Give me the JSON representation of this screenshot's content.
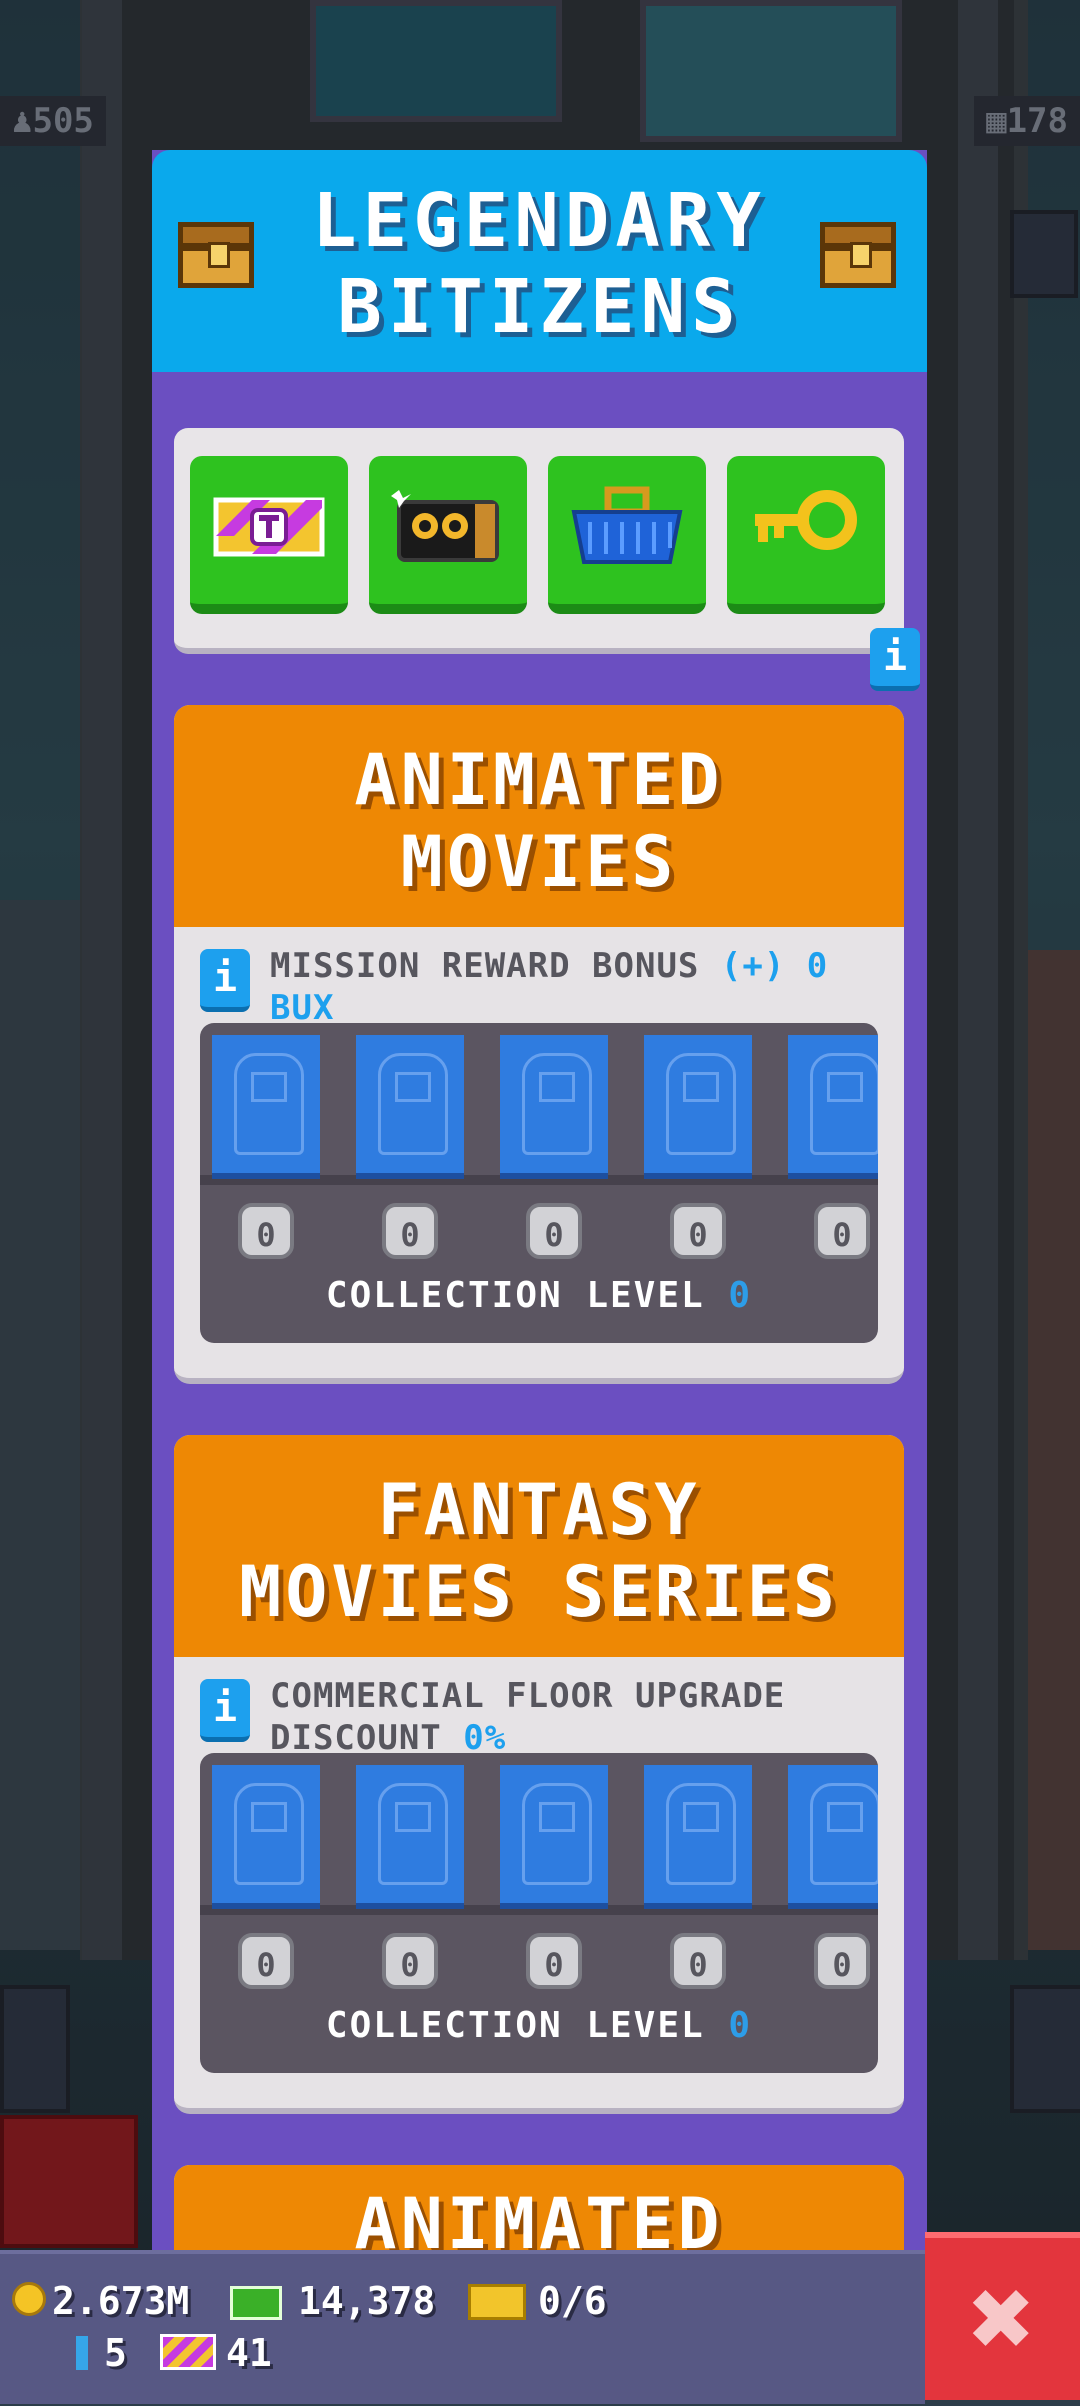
{
  "hud": {
    "population": "505",
    "floors": "178"
  },
  "header": {
    "title": "LEGENDARY\nBITIZENS"
  },
  "tools": [
    {
      "name": "tower-bux-ticket"
    },
    {
      "name": "vip-camera"
    },
    {
      "name": "shopping-basket"
    },
    {
      "name": "golden-key"
    }
  ],
  "info_label": "i",
  "collections": [
    {
      "title": "ANIMATED\nMOVIES",
      "bonus_label": "MISSION REWARD BONUS ",
      "bonus_value": "(+) 0 BUX",
      "counts": [
        "0",
        "0",
        "0",
        "0",
        "0"
      ],
      "level_label": "COLLECTION LEVEL ",
      "level_value": "0"
    },
    {
      "title": "FANTASY\nMOVIES  SERIES",
      "bonus_label": "COMMERCIAL FLOOR UPGRADE DISCOUNT ",
      "bonus_value": "0%",
      "counts": [
        "0",
        "0",
        "0",
        "0",
        "0"
      ],
      "level_label": "COLLECTION LEVEL ",
      "level_value": "0"
    },
    {
      "title": "ANIMATED"
    }
  ],
  "resources": {
    "coins": "2.673M",
    "bux": "14,378",
    "tickets": "0/6",
    "crystals": "5",
    "tower_bux": "41"
  },
  "close_label": "✖",
  "colors": {
    "header_blue": "#0aa9ec",
    "panel_purple": "#6b4fc1",
    "collection_orange": "#ee8804",
    "tool_green": "#2ec21f",
    "close_red": "#e3353d",
    "highlight_blue": "#1da0ee"
  }
}
